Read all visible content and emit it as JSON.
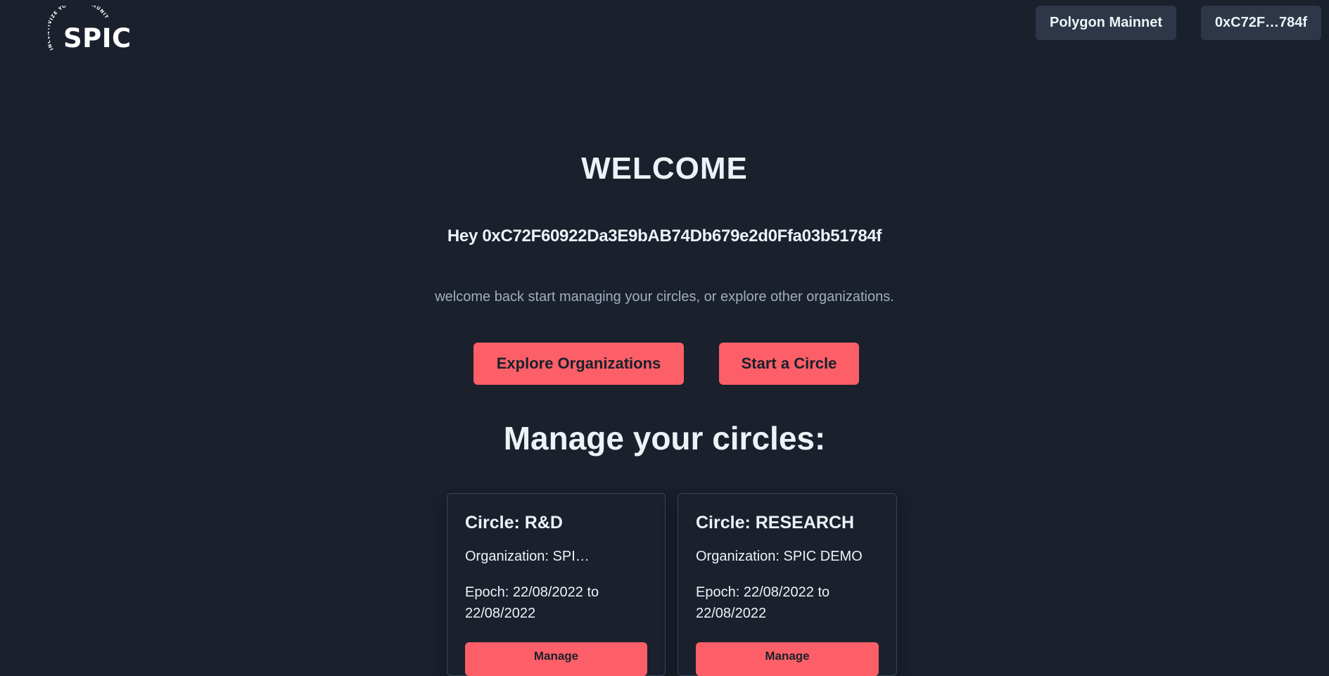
{
  "header": {
    "logo_text": "SPIC",
    "logo_tagline": "INCENTIVIZE YOUR COMMUNITY",
    "network_label": "Polygon Mainnet",
    "wallet_label": "0xC72F…784f"
  },
  "hero": {
    "title": "WELCOME",
    "greeting": "Hey 0xC72F60922Da3E9bAB74Db679e2d0Ffa03b51784f",
    "subtitle": "welcome back start managing your circles, or explore other organizations.",
    "explore_label": "Explore Organizations",
    "start_label": "Start a Circle"
  },
  "circles": {
    "heading": "Manage your circles:",
    "items": [
      {
        "title": "Circle: R&D",
        "organization": "Organization: SPIC…",
        "epoch": "Epoch: 22/08/2022 to 22/08/2022",
        "button_label": "Manage"
      },
      {
        "title": "Circle: RESEARCH",
        "organization": "Organization: SPIC DEMO",
        "epoch": "Epoch: 22/08/2022 to 22/08/2022",
        "button_label": "Manage"
      }
    ]
  },
  "colors": {
    "background": "#1a202c",
    "accent": "#fc5f67",
    "header_button": "#2d3748",
    "muted_text": "#a0aec0"
  }
}
